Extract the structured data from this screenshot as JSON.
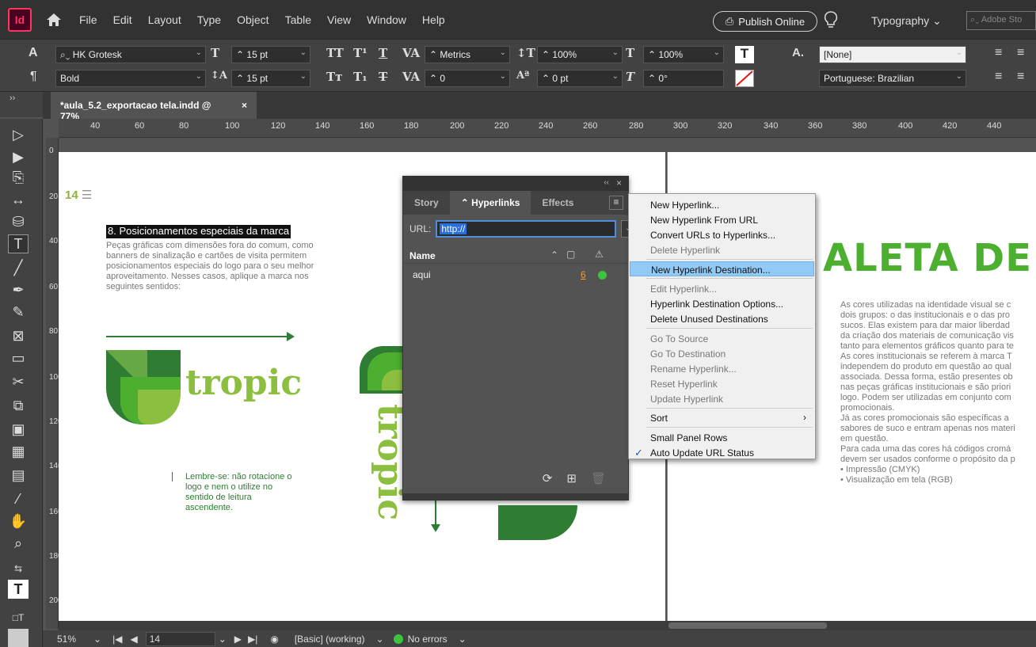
{
  "app": {
    "logo": "Id"
  },
  "menu": [
    "File",
    "Edit",
    "Layout",
    "Type",
    "Object",
    "Table",
    "View",
    "Window",
    "Help"
  ],
  "publish_label": "Publish Online",
  "workspace": "Typography",
  "search_placeholder": "Adobe Sto",
  "control": {
    "font_family": "HK Grotesk",
    "font_style": "Bold",
    "font_size": "15 pt",
    "leading": "15 pt",
    "kerning": "Metrics",
    "tracking": "0",
    "vscale": "100%",
    "hscale": "100%",
    "baseline": "0 pt",
    "skew": "0°",
    "char_style": "[None]",
    "language": "Portuguese: Brazilian"
  },
  "doc_tab": {
    "title": "*aula_5.2_exportacao tela.indd @ 77%",
    "close": "×"
  },
  "ruler_h": [
    "40",
    "60",
    "80",
    "100",
    "120",
    "140",
    "160",
    "180",
    "200",
    "220",
    "240",
    "260",
    "280",
    "300",
    "320",
    "340",
    "360",
    "380",
    "400",
    "420",
    "440"
  ],
  "ruler_v": [
    "0",
    "20",
    "40",
    "60",
    "80",
    "100",
    "120",
    "140",
    "160",
    "180",
    "200"
  ],
  "page_left": {
    "page_no": "14",
    "title": "8. Posicionamentos especiais da marca",
    "body": "Peças gráficas com dimensões fora do comum, como banners de sinalização e cartões de visita permitem posicionamentos especiais do logo para o seu melhor aproveitamento. Nesses casos, aplique a marca nos seguintes sentidos:",
    "brand": "tropic",
    "brand_v": "tropic",
    "note": "Lembre-se: não rotacione o logo e nem o utilize no sentido de leitura ascendente."
  },
  "page_right": {
    "heading": "ALETA DE COI",
    "body": "As cores utilizadas na identidade visual se c\ndois grupos: o das institucionais e o das pro\nsucos. Elas existem para dar maior liberdad\nda criação dos materiais de comunicação vis\ntanto para elementos gráficos quanto para te\nAs cores institucionais se referem à marca T\nindependem do produto em questão ao qual\nassociada. Dessa forma, estão presentes ob\nnas peças gráficas institucionais e são priori\nlogo. Podem ser utilizadas em conjunto com\npromocionais.\nJá as cores promocionais são específicas a\nsabores de suco e entram apenas nos materi\nem questão.\nPara cada uma das cores há códigos cromá\ndevem ser usados conforme o propósito da p\n• Impressão (CMYK)\n• Visualização em tela (RGB)"
  },
  "hyperlinks_panel": {
    "tabs": [
      "Story",
      "Hyperlinks",
      "Effects"
    ],
    "url_label": "URL:",
    "url_value": "http://",
    "col_name": "Name",
    "rows": [
      {
        "name": "aqui",
        "page": "6"
      }
    ]
  },
  "flyout": {
    "items": [
      {
        "label": "New Hyperlink...",
        "disabled": false
      },
      {
        "label": "New Hyperlink From URL",
        "disabled": false
      },
      {
        "label": "Convert URLs to Hyperlinks...",
        "disabled": false
      },
      {
        "label": "Delete Hyperlink",
        "disabled": true
      },
      {
        "label": "New Hyperlink Destination...",
        "disabled": false,
        "highlight": true
      },
      {
        "label": "Edit Hyperlink...",
        "disabled": true
      },
      {
        "label": "Hyperlink Destination Options...",
        "disabled": false
      },
      {
        "label": "Delete Unused Destinations",
        "disabled": false
      },
      {
        "label": "Go To Source",
        "disabled": true
      },
      {
        "label": "Go To Destination",
        "disabled": true
      },
      {
        "label": "Rename Hyperlink...",
        "disabled": true
      },
      {
        "label": "Reset Hyperlink",
        "disabled": true
      },
      {
        "label": "Update Hyperlink",
        "disabled": true
      },
      {
        "label": "Sort",
        "disabled": false
      },
      {
        "label": "Small Panel Rows",
        "disabled": false
      },
      {
        "label": "Auto Update URL Status",
        "disabled": false,
        "checked": true
      }
    ]
  },
  "status": {
    "zoom": "51%",
    "page": "14",
    "style": "[Basic] (working)",
    "preflight": "No errors"
  },
  "colors": {
    "accent": "#4d8fe0",
    "brand_green": "#4caf30",
    "leaf_dark": "#2e7d32",
    "leaf_light": "#8cbf3f"
  }
}
